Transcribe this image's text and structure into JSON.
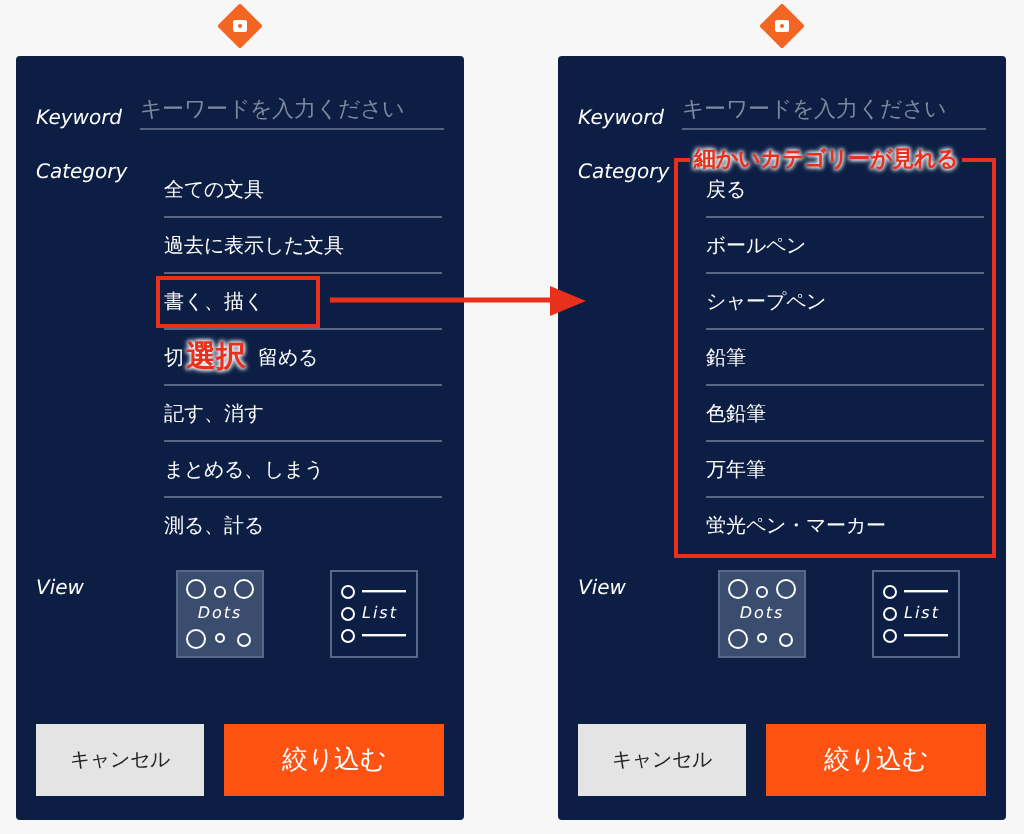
{
  "screens": [
    {
      "keyword": {
        "label": "Keyword",
        "placeholder": "キーワードを入力ください"
      },
      "category": {
        "label": "Category",
        "items": [
          {
            "kind": "plain",
            "text": "全ての文具",
            "highlighted": false
          },
          {
            "kind": "plain",
            "text": "過去に表示した文具",
            "highlighted": false
          },
          {
            "kind": "plain",
            "text": "書く、描く",
            "highlighted": true
          },
          {
            "kind": "covered",
            "parts": [
              "切",
              "留める"
            ],
            "callout": "選択"
          },
          {
            "kind": "plain",
            "text": "記す、消す",
            "highlighted": false
          },
          {
            "kind": "plain",
            "text": "まとめる、しまう",
            "highlighted": false
          },
          {
            "kind": "plain",
            "text": "測る、計る",
            "highlighted": false
          }
        ]
      },
      "view": {
        "label": "View",
        "options": [
          {
            "kind": "dots",
            "label": "Dots",
            "selected": true
          },
          {
            "kind": "list",
            "label": "List",
            "selected": false
          }
        ]
      },
      "buttons": {
        "cancel": "キャンセル",
        "apply": "絞り込む"
      }
    },
    {
      "keyword": {
        "label": "Keyword",
        "placeholder": "キーワードを入力ください"
      },
      "category": {
        "label": "Category",
        "callout": "細かいカテゴリーが見れる",
        "items": [
          {
            "kind": "plain",
            "text": "戻る",
            "highlighted": false
          },
          {
            "kind": "plain",
            "text": "ボールペン",
            "highlighted": false
          },
          {
            "kind": "plain",
            "text": "シャープペン",
            "highlighted": false
          },
          {
            "kind": "plain",
            "text": "鉛筆",
            "highlighted": false
          },
          {
            "kind": "plain",
            "text": "色鉛筆",
            "highlighted": false
          },
          {
            "kind": "plain",
            "text": "万年筆",
            "highlighted": false
          },
          {
            "kind": "plain",
            "text": "蛍光ペン・マーカー",
            "highlighted": false
          }
        ]
      },
      "view": {
        "label": "View",
        "options": [
          {
            "kind": "dots",
            "label": "Dots",
            "selected": true
          },
          {
            "kind": "list",
            "label": "List",
            "selected": false
          }
        ]
      },
      "buttons": {
        "cancel": "キャンセル",
        "apply": "絞り込む"
      }
    }
  ]
}
